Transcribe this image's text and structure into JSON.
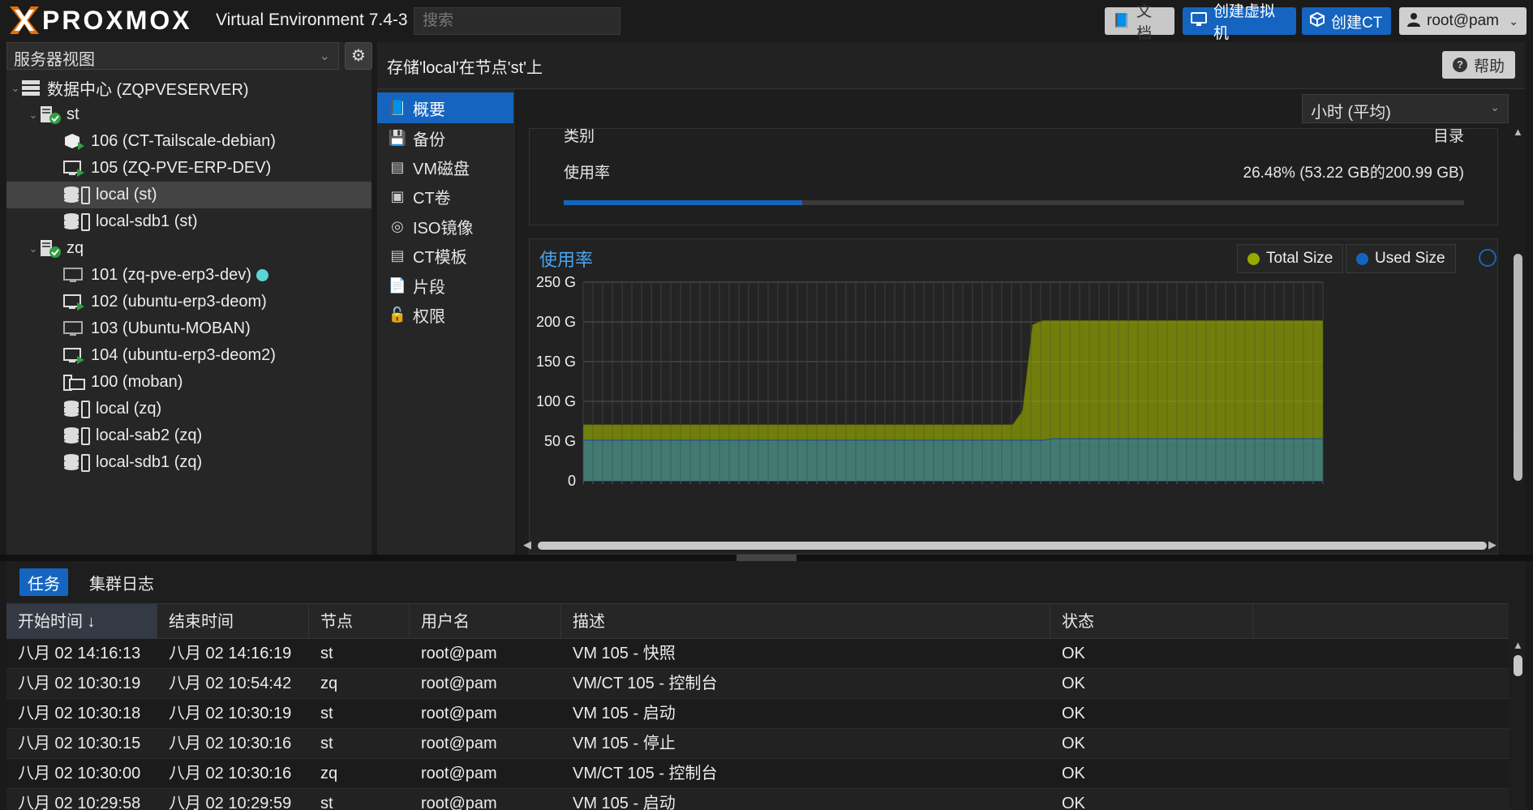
{
  "brand": {
    "logo_text": "PROXMOX",
    "product": "Virtual Environment 7.4-3"
  },
  "search": {
    "placeholder": "搜索"
  },
  "toolbar": {
    "docs_label": "文档",
    "create_vm_label": "创建虚拟机",
    "create_ct_label": "创建CT",
    "user_label": "root@pam"
  },
  "sidebar": {
    "view_label": "服务器视图",
    "tree": [
      {
        "label": "数据中心 (ZQPVESERVER)",
        "kind": "datacenter",
        "level": 0
      },
      {
        "label": "st",
        "kind": "node",
        "level": 1
      },
      {
        "label": "106 (CT-Tailscale-debian)",
        "kind": "ct-running",
        "level": 2
      },
      {
        "label": "105 (ZQ-PVE-ERP-DEV)",
        "kind": "vm-running",
        "level": 2
      },
      {
        "label": "local (st)",
        "kind": "storage",
        "level": 2,
        "selected": true
      },
      {
        "label": "local-sdb1 (st)",
        "kind": "storage",
        "level": 2
      },
      {
        "label": "zq",
        "kind": "node",
        "level": 1
      },
      {
        "label": "101 (zq-pve-erp3-dev)",
        "kind": "vm-stopped",
        "level": 2,
        "badge": true
      },
      {
        "label": "102 (ubuntu-erp3-deom)",
        "kind": "vm-running",
        "level": 2
      },
      {
        "label": "103 (Ubuntu-MOBAN)",
        "kind": "vm-stopped",
        "level": 2
      },
      {
        "label": "104 (ubuntu-erp3-deom2)",
        "kind": "vm-running",
        "level": 2
      },
      {
        "label": "100 (moban)",
        "kind": "template",
        "level": 2
      },
      {
        "label": "local (zq)",
        "kind": "storage",
        "level": 2
      },
      {
        "label": "local-sab2 (zq)",
        "kind": "storage",
        "level": 2
      },
      {
        "label": "local-sdb1 (zq)",
        "kind": "storage",
        "level": 2
      }
    ]
  },
  "center": {
    "title": "存储'local'在节点'st'上",
    "help_label": "帮助",
    "nav": [
      {
        "label": "概要",
        "icon": "book-icon",
        "active": true
      },
      {
        "label": "备份",
        "icon": "floppy-icon"
      },
      {
        "label": "VM磁盘",
        "icon": "hdd-icon"
      },
      {
        "label": "CT卷",
        "icon": "ct-volume-icon"
      },
      {
        "label": "ISO镜像",
        "icon": "disc-icon"
      },
      {
        "label": "CT模板",
        "icon": "ct-template-icon"
      },
      {
        "label": "片段",
        "icon": "snippet-icon"
      },
      {
        "label": "权限",
        "icon": "unlock-icon"
      }
    ]
  },
  "summary": {
    "timeframe": "小时 (平均)",
    "type_label": "类别",
    "type_value": "目录",
    "usage_label": "使用率",
    "usage_value": "26.48% (53.22 GB的200.99 GB)",
    "usage_fraction": 0.2648
  },
  "colors": {
    "total": "#98a900",
    "used": "#1565c0",
    "accent": "#1565c0"
  },
  "chart_data": {
    "type": "area",
    "title": "使用率",
    "ytick_labels": [
      "250 G",
      "200 G",
      "150 G",
      "100 G",
      "50 G",
      "0"
    ],
    "ylim": [
      0,
      250
    ],
    "series": [
      {
        "name": "Total Size",
        "color": "#98a900",
        "values": [
          70,
          70,
          70,
          70,
          70,
          70,
          70,
          70,
          70,
          70,
          70,
          70,
          70,
          70,
          70,
          70,
          70,
          70,
          70,
          70,
          70,
          70,
          70,
          70,
          70,
          70,
          70,
          70,
          70,
          70,
          70,
          70,
          70,
          70,
          70,
          70,
          70,
          70,
          70,
          70,
          70,
          70,
          70,
          70,
          88,
          196,
          201,
          201,
          201,
          201,
          201,
          201,
          201,
          201,
          201,
          201,
          201,
          201,
          201,
          201,
          201,
          201,
          201,
          201,
          201,
          201,
          201,
          201,
          201,
          201,
          201,
          201,
          201,
          201,
          201
        ]
      },
      {
        "name": "Used Size",
        "color": "#1565c0",
        "values": [
          51,
          51,
          51,
          51,
          51,
          51,
          51,
          51,
          51,
          51,
          51,
          51,
          51,
          51,
          51,
          51,
          51,
          51,
          51,
          51,
          51,
          51,
          51,
          51,
          51,
          51,
          51,
          51,
          51,
          51,
          51,
          51,
          51,
          51,
          51,
          51,
          51,
          51,
          51,
          51,
          51,
          51,
          51,
          51,
          51,
          51,
          51,
          53,
          53,
          53,
          53,
          53,
          53,
          53,
          53,
          53,
          53,
          53,
          53,
          53,
          53,
          53,
          53,
          53,
          53,
          53,
          53,
          53,
          53,
          53,
          53,
          53,
          53,
          53,
          53
        ]
      }
    ]
  },
  "log": {
    "tabs": [
      "任务",
      "集群日志"
    ],
    "columns": [
      "开始时间 ↓",
      "结束时间",
      "节点",
      "用户名",
      "描述",
      "状态"
    ],
    "rows": [
      [
        "八月 02 14:16:13",
        "八月 02 14:16:19",
        "st",
        "root@pam",
        "VM 105 - 快照",
        "OK"
      ],
      [
        "八月 02 10:30:19",
        "八月 02 10:54:42",
        "zq",
        "root@pam",
        "VM/CT 105 - 控制台",
        "OK"
      ],
      [
        "八月 02 10:30:18",
        "八月 02 10:30:19",
        "st",
        "root@pam",
        "VM 105 - 启动",
        "OK"
      ],
      [
        "八月 02 10:30:15",
        "八月 02 10:30:16",
        "st",
        "root@pam",
        "VM 105 - 停止",
        "OK"
      ],
      [
        "八月 02 10:30:00",
        "八月 02 10:30:16",
        "zq",
        "root@pam",
        "VM/CT 105 - 控制台",
        "OK"
      ],
      [
        "八月 02 10:29:58",
        "八月 02 10:29:59",
        "st",
        "root@pam",
        "VM 105 - 启动",
        "OK"
      ]
    ]
  }
}
